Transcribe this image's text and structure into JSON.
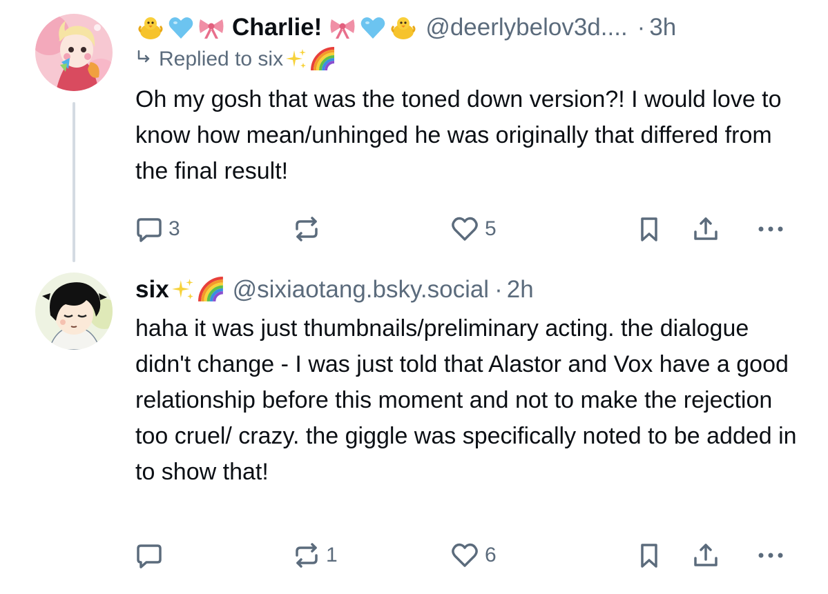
{
  "posts": [
    {
      "author": {
        "display_name": "Charlie!",
        "handle": "@deerlybelov3d....",
        "emoji_left": [
          "baby-chick-emoji",
          "blue-heart-emoji",
          "ribbon-emoji"
        ],
        "emoji_right": [
          "ribbon-emoji",
          "blue-heart-emoji",
          "baby-chick-emoji"
        ]
      },
      "separator": "·",
      "time": "3h",
      "reply_to": {
        "label": "Replied to six",
        "emoji": [
          "sparkles-emoji",
          "rainbow-emoji"
        ]
      },
      "text": "Oh my gosh that was the toned down version?! I would love to know how mean/unhinged he was originally that differed from the final result!",
      "actions": {
        "reply_count": "3",
        "repost_count": "",
        "like_count": "5"
      }
    },
    {
      "author": {
        "display_name": "six",
        "handle": "@sixiaotang.bsky.social",
        "emoji_right": [
          "sparkles-emoji",
          "rainbow-emoji"
        ]
      },
      "separator": "·",
      "time": "2h",
      "text": "haha it was just thumbnails/preliminary acting. the dialogue didn't change - I was just told that Alastor and Vox have a good relationship before this moment and not to make the rejection too cruel/ crazy. the giggle was specifically noted to be added in to show that!",
      "actions": {
        "reply_count": "",
        "repost_count": "1",
        "like_count": "6"
      }
    }
  ],
  "colors": {
    "text": "#0b0f14",
    "muted": "#5b6b7c",
    "thread_line": "#d4dbe2"
  }
}
